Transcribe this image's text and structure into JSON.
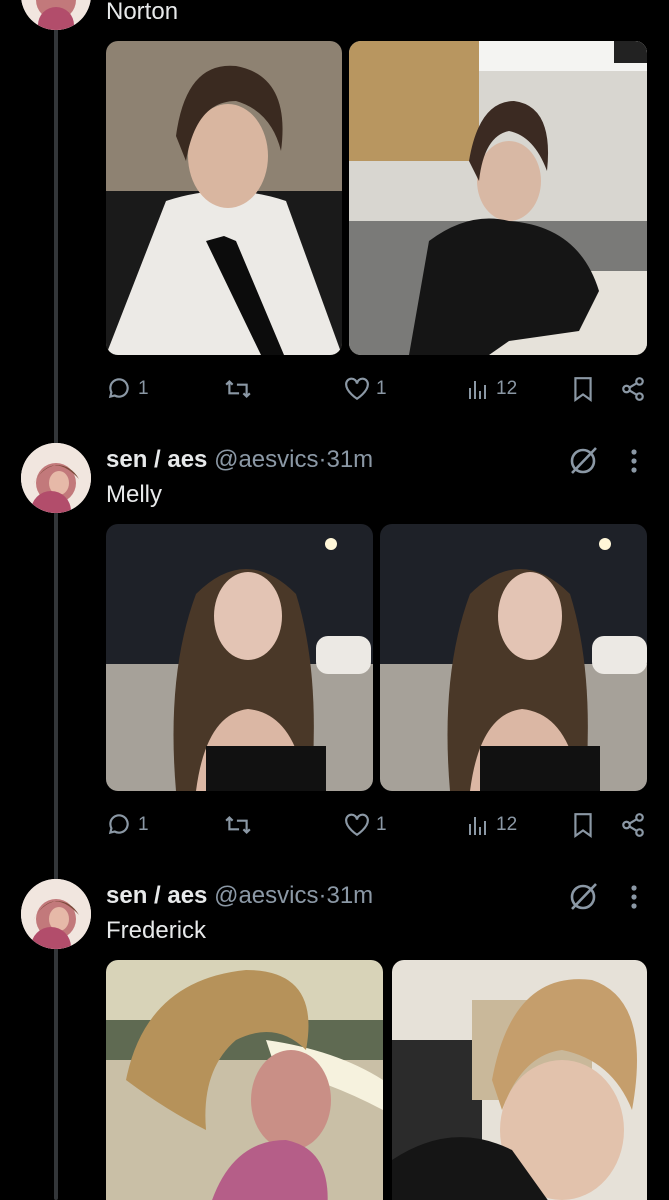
{
  "posts": [
    {
      "text": "Norton",
      "stats": {
        "replies": "1",
        "likes": "1",
        "views": "12"
      }
    },
    {
      "author": {
        "name": "sen / aes",
        "handle": "@aesvics",
        "dot": "·",
        "time": "31m"
      },
      "text": "Melly",
      "stats": {
        "replies": "1",
        "likes": "1",
        "views": "12"
      }
    },
    {
      "author": {
        "name": "sen / aes",
        "handle": "@aesvics",
        "dot": "·",
        "time": "31m"
      },
      "text": "Frederick"
    }
  ],
  "icons": {
    "reply": "reply-icon",
    "repost": "repost-icon",
    "like": "heart-icon",
    "views": "views-chart-icon",
    "bookmark": "bookmark-icon",
    "share": "share-icon",
    "grok": "grok-slash-circle-icon",
    "more": "more-vertical-icon"
  },
  "colors": {
    "background": "#000000",
    "text": "#e7e9ea",
    "muted": "#8b98a5",
    "thread_line": "#333639"
  }
}
